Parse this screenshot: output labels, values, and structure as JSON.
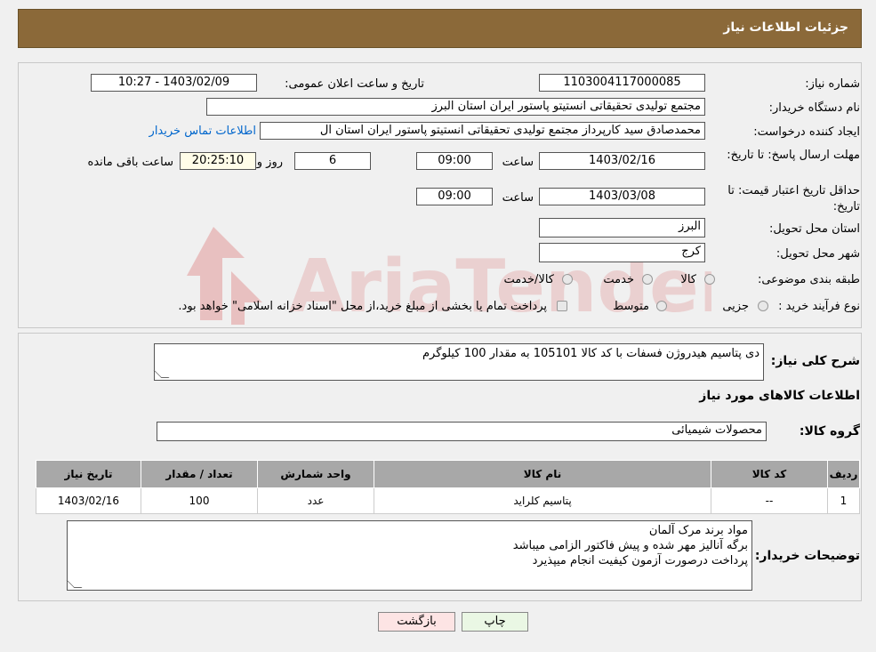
{
  "header": {
    "title": "جزئیات اطلاعات نیاز"
  },
  "watermark": {
    "text": "AriaTender.neT",
    "color": "#e8c0c0"
  },
  "fields": {
    "need_number_label": "شماره نیاز:",
    "need_number": "1103004117000085",
    "announce_label": "تاریخ و ساعت اعلان عمومی:",
    "announce_value": "1403/02/09 - 10:27",
    "buyer_org_label": "نام دستگاه خریدار:",
    "buyer_org": "مجتمع تولیدی تحقیقاتی انستیتو پاستور ایران استان البرز",
    "requester_label": "ایجاد کننده درخواست:",
    "requester": "محمدصادق سید کارپرداز مجتمع تولیدی تحقیقاتی انستیتو پاستور ایران استان ال",
    "contact_link": "اطلاعات تماس خریدار",
    "deadline_label": "مهلت ارسال پاسخ: تا تاریخ:",
    "deadline_date": "1403/02/16",
    "time_label": "ساعت",
    "deadline_time": "09:00",
    "days_value": "6",
    "days_label": "روز و",
    "remaining_time": "20:25:10",
    "remaining_label": "ساعت باقی مانده",
    "validity_label": "حداقل تاریخ اعتبار قیمت: تا تاریخ:",
    "validity_date": "1403/03/08",
    "validity_time": "09:00",
    "province_label": "استان محل تحویل:",
    "province": "البرز",
    "city_label": "شهر محل تحویل:",
    "city": "کرج",
    "category_label": "طبقه بندی موضوعی:",
    "category_options": [
      "کالا",
      "خدمت",
      "کالا/خدمت"
    ],
    "process_label": "نوع فرآیند خرید :",
    "process_options": [
      "جزیی",
      "متوسط"
    ],
    "payment_note": "پرداخت تمام یا بخشی از مبلغ خرید،از محل \"اسناد خزانه اسلامی\" خواهد بود."
  },
  "description": {
    "label": "شرح کلی نیاز:",
    "value": "دی پتاسیم هیدروژن فسفات با کد کالا 105101 به مقدار 100 کیلوگرم"
  },
  "goods": {
    "section_title": "اطلاعات کالاهای مورد نیاز",
    "group_label": "گروه کالا:",
    "group_value": "محصولات شیمیائی",
    "columns": [
      "ردیف",
      "کد کالا",
      "نام کالا",
      "واحد شمارش",
      "تعداد / مقدار",
      "تاریخ نیاز"
    ],
    "rows": [
      [
        "1",
        "--",
        "پتاسیم کلراید",
        "عدد",
        "100",
        "1403/02/16"
      ]
    ]
  },
  "buyer_notes": {
    "label": "توضیحات خریدار:",
    "lines": [
      "مواد برند مرک آلمان",
      "برگه آنالیز مهر شده و پیش فاکتور الزامی میباشد",
      "پرداخت درصورت آزمون کیفیت انجام میپذیرد"
    ]
  },
  "buttons": {
    "print": "چاپ",
    "back": "بازگشت"
  },
  "colors": {
    "header": "#8b6939",
    "back_button": "#fde4e4",
    "print_button": "#eaf7e4",
    "remaining_box": "#fffde8"
  }
}
